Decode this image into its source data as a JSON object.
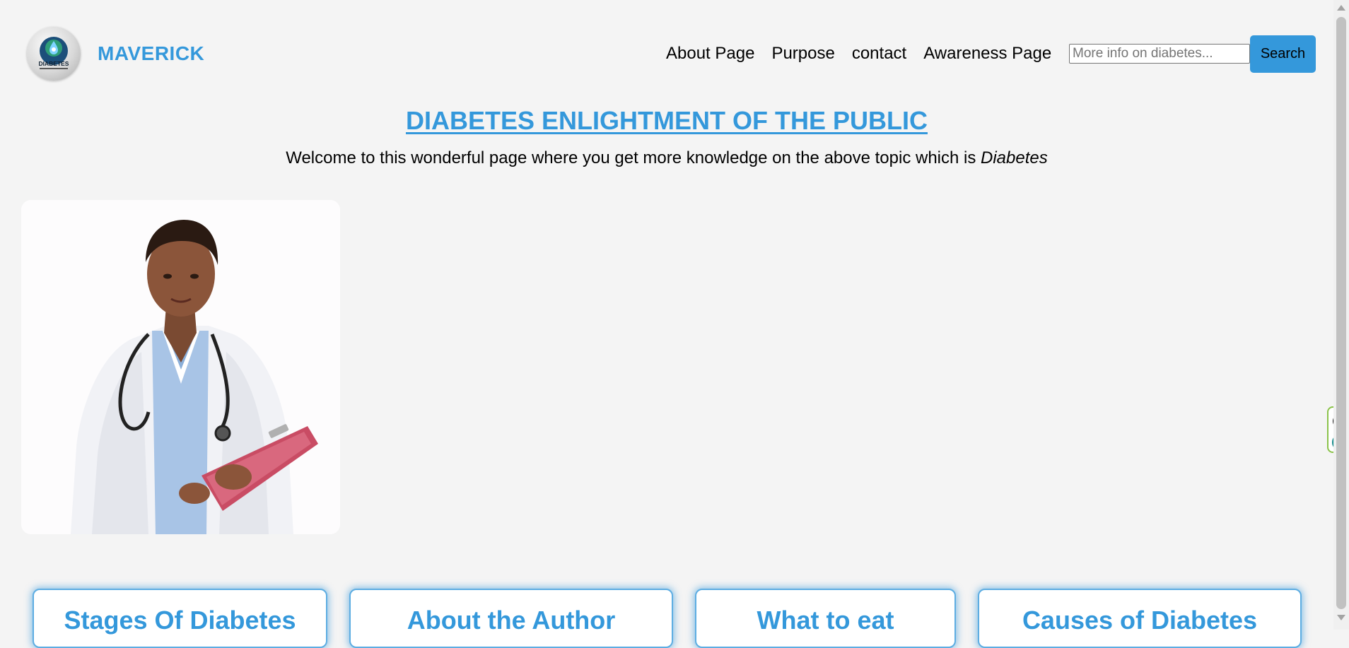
{
  "header": {
    "logo": {
      "icon": "diabetes-logo-icon",
      "text": "DIABETES"
    },
    "brand": "MAVERICK",
    "nav": [
      {
        "label": "About Page"
      },
      {
        "label": "Purpose"
      },
      {
        "label": "contact"
      },
      {
        "label": "Awareness Page"
      }
    ],
    "search": {
      "placeholder": "More info on diabetes...",
      "value": "",
      "button_label": "Search"
    }
  },
  "hero": {
    "title": "DIABETES ENLIGHTMENT OF THE PUBLIC",
    "subtitle_prefix": "Welcome to this wonderful page where you get more knowledge on the above topic which is ",
    "subtitle_emphasis": "Diabetes"
  },
  "image": {
    "subject": "doctor-photo"
  },
  "cards": [
    {
      "title": "Stages Of Diabetes"
    },
    {
      "title": "About the Author"
    },
    {
      "title": "What to eat"
    },
    {
      "title": "Causes of Diabetes"
    }
  ],
  "colors": {
    "accent": "#3498db",
    "background": "#f4f4f4",
    "card_glow": "#5dade2"
  },
  "extension": {
    "close_icon": "close-icon",
    "logo_icon": "extension-e-icon",
    "logo_letter": "e"
  }
}
